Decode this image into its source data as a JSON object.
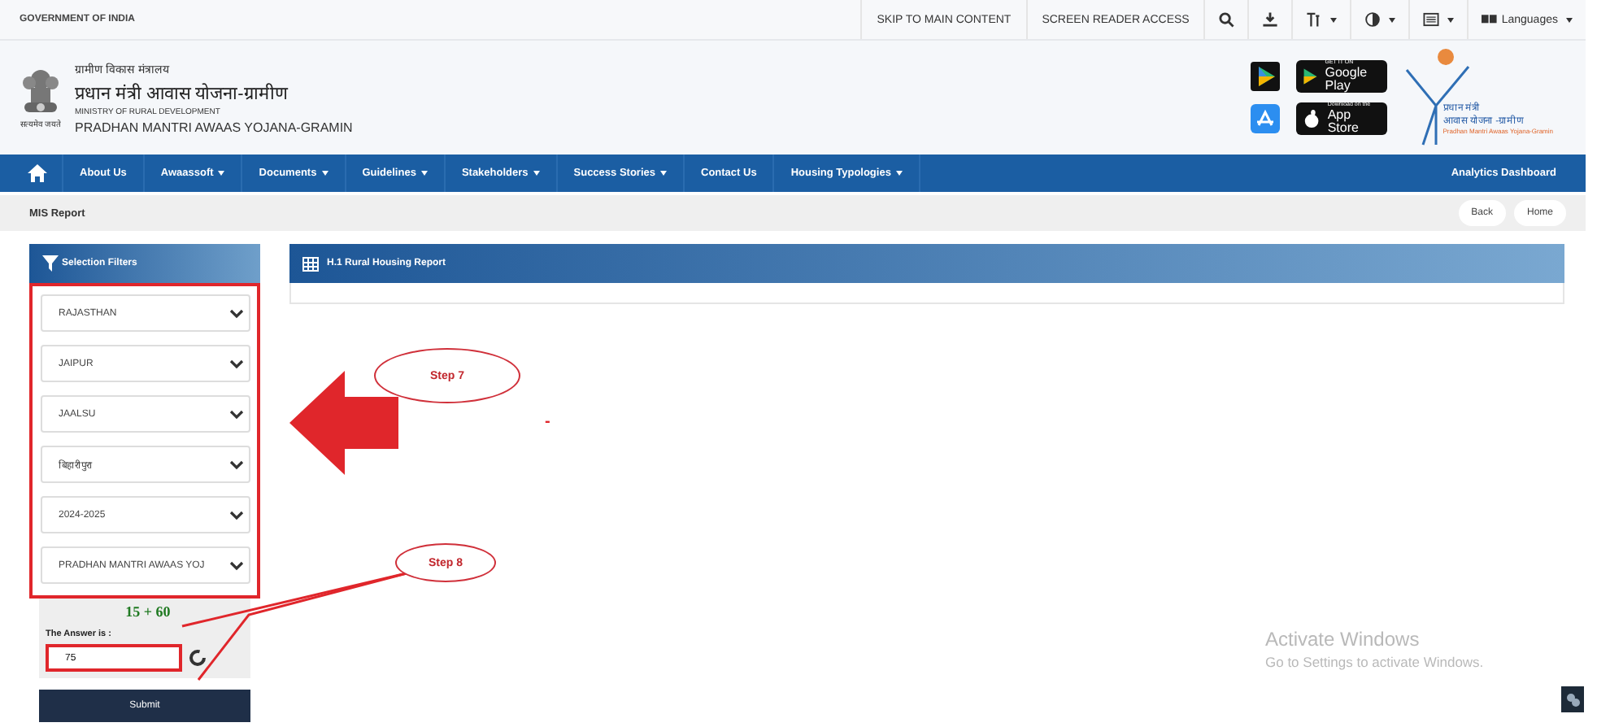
{
  "top_bar": {
    "label": "GOVERNMENT OF INDIA",
    "links": [
      "SKIP TO MAIN CONTENT",
      "SCREEN READER ACCESS"
    ],
    "tools": [
      {
        "kind": "search",
        "dropdown": false
      },
      {
        "kind": "download",
        "dropdown": false
      },
      {
        "kind": "text-size",
        "dropdown": true
      },
      {
        "kind": "contrast",
        "dropdown": true
      },
      {
        "kind": "sitemap",
        "dropdown": true
      },
      {
        "kind": "language",
        "dropdown": true,
        "label": "Languages"
      }
    ]
  },
  "header": {
    "emblem_caption": "सत्यमेव जयते",
    "ministry_hindi": "ग्रामीण विकास मंत्रालय",
    "program_hindi": "प्रधान मंत्री आवास योजना-ग्रामीण",
    "ministry_en": "MINISTRY OF RURAL DEVELOPMENT",
    "program_en": "PRADHAN MANTRI AWAAS YOJANA-GRAMIN",
    "stores": [
      {
        "kind": "google-play",
        "small": "GET IT ON",
        "label": "Google Play"
      },
      {
        "kind": "app-store",
        "small": "Download on the",
        "label": "App Store"
      }
    ],
    "logo_lines": [
      "प्रधान मंत्री",
      "आवास योजना -ग्रामीण",
      "Pradhan Mantri Awaas Yojana-Gramin"
    ]
  },
  "nav": {
    "items": [
      {
        "label": "About Us",
        "dropdown": false
      },
      {
        "label": "Awaassoft",
        "dropdown": true
      },
      {
        "label": "Documents",
        "dropdown": true
      },
      {
        "label": "Guidelines",
        "dropdown": true
      },
      {
        "label": "Stakeholders",
        "dropdown": true
      },
      {
        "label": "Success Stories",
        "dropdown": true
      },
      {
        "label": "Contact Us",
        "dropdown": false
      },
      {
        "label": "Housing Typologies",
        "dropdown": true
      }
    ],
    "right": "Analytics Dashboard"
  },
  "breadcrumb": {
    "title": "MIS Report",
    "buttons": [
      "Back",
      "Home"
    ]
  },
  "filters": {
    "title": "Selection Filters",
    "highlighted": true,
    "selects": [
      "RAJASTHAN",
      "JAIPUR",
      "JAALSU",
      "बिहारीपुरा",
      "2024-2025",
      "PRADHAN MANTRI AWAAS YOJ"
    ],
    "captcha": "15 + 60",
    "answer_label": "The Answer is :",
    "answer": "75",
    "answer_highlighted": true,
    "submit": "Submit"
  },
  "report": {
    "title": "H.1 Rural Housing Report",
    "message": "-"
  },
  "annotations": [
    {
      "label": "Step 7"
    },
    {
      "label": "Step 8"
    }
  ],
  "os_notice": {
    "title": "Activate Windows",
    "text": "Go to Settings to activate Windows."
  }
}
